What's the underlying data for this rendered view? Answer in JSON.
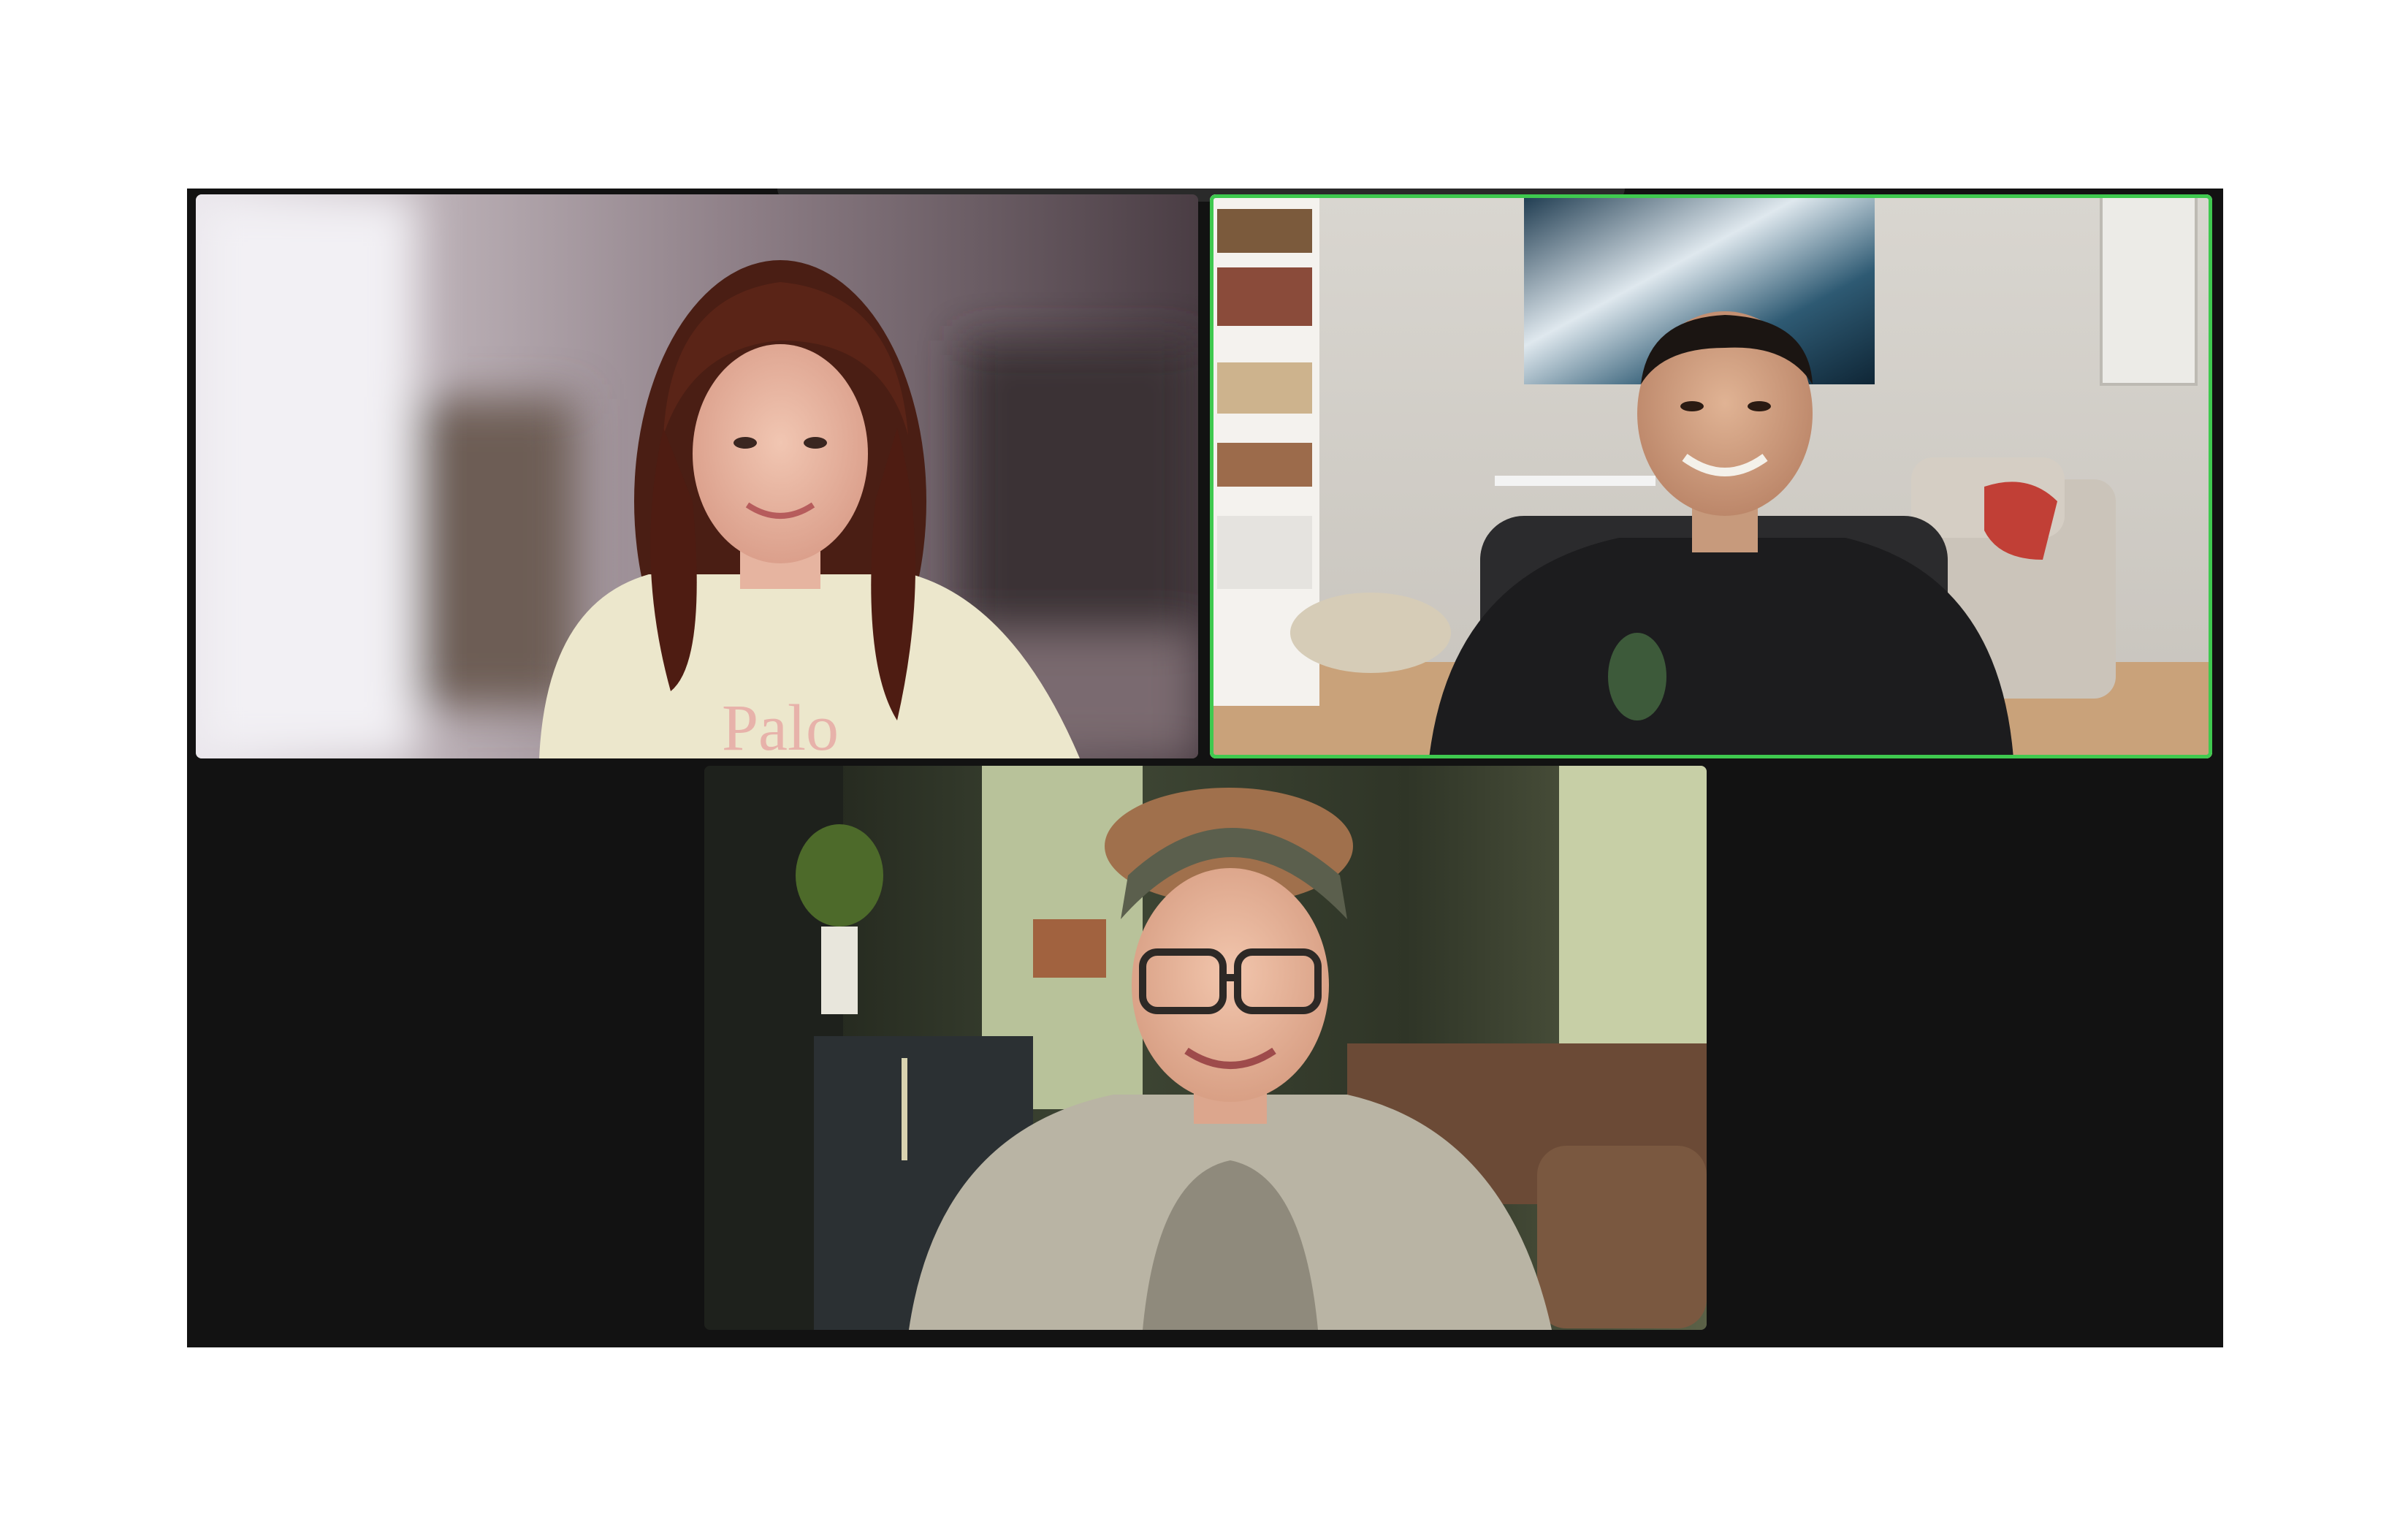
{
  "meeting": {
    "participants": [
      {
        "id": "participant-1",
        "active_speaker": false
      },
      {
        "id": "participant-2",
        "active_speaker": true
      },
      {
        "id": "participant-3",
        "active_speaker": false
      }
    ],
    "colors": {
      "background": "#121212",
      "active_speaker_border": "#3fc94f",
      "page_background": "#ffffff"
    },
    "icons": [
      "camera-feed-image"
    ]
  }
}
